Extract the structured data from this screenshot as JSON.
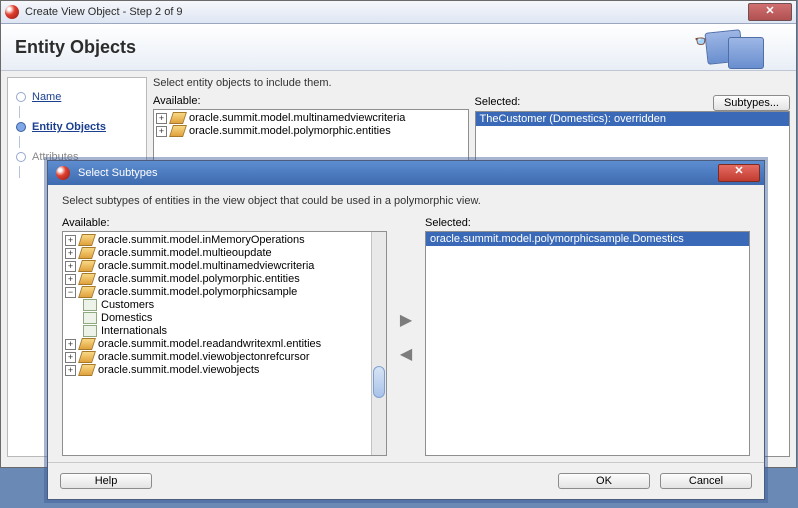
{
  "wizard": {
    "title": "Create View Object - Step 2 of 9",
    "heading": "Entity Objects",
    "description": "Select entity objects to include them.",
    "steps": {
      "name": "Name",
      "entity": "Entity Objects",
      "attributes": "Attributes"
    },
    "available_label": "Available:",
    "selected_label": "Selected:",
    "subtypes_btn": "Subtypes...",
    "available_items": [
      "oracle.summit.model.multinamedviewcriteria",
      "oracle.summit.model.polymorphic.entities"
    ],
    "selected_item": "TheCustomer (Domestics): overridden"
  },
  "modal": {
    "title": "Select Subtypes",
    "description": "Select subtypes of entities in the view object that could be used in a polymorphic view.",
    "available_label": "Available:",
    "selected_label": "Selected:",
    "help_btn": "Help",
    "ok_btn": "OK",
    "cancel_btn": "Cancel",
    "selected_item": "oracle.summit.model.polymorphicsample.Domestics",
    "tree": {
      "inmem": "oracle.summit.model.inMemoryOperations",
      "multieo": "oracle.summit.model.multieoupdate",
      "multinamed": "oracle.summit.model.multinamedviewcriteria",
      "polyent": "oracle.summit.model.polymorphic.entities",
      "polysample": "oracle.summit.model.polymorphicsample",
      "polysample_children": {
        "customers": "Customers",
        "domestics": "Domestics",
        "internationals": "Internationals"
      },
      "readwrite": "oracle.summit.model.readandwritexml.entities",
      "viewobjref": "oracle.summit.model.viewobjectonrefcursor",
      "viewobjects": "oracle.summit.model.viewobjects"
    }
  }
}
